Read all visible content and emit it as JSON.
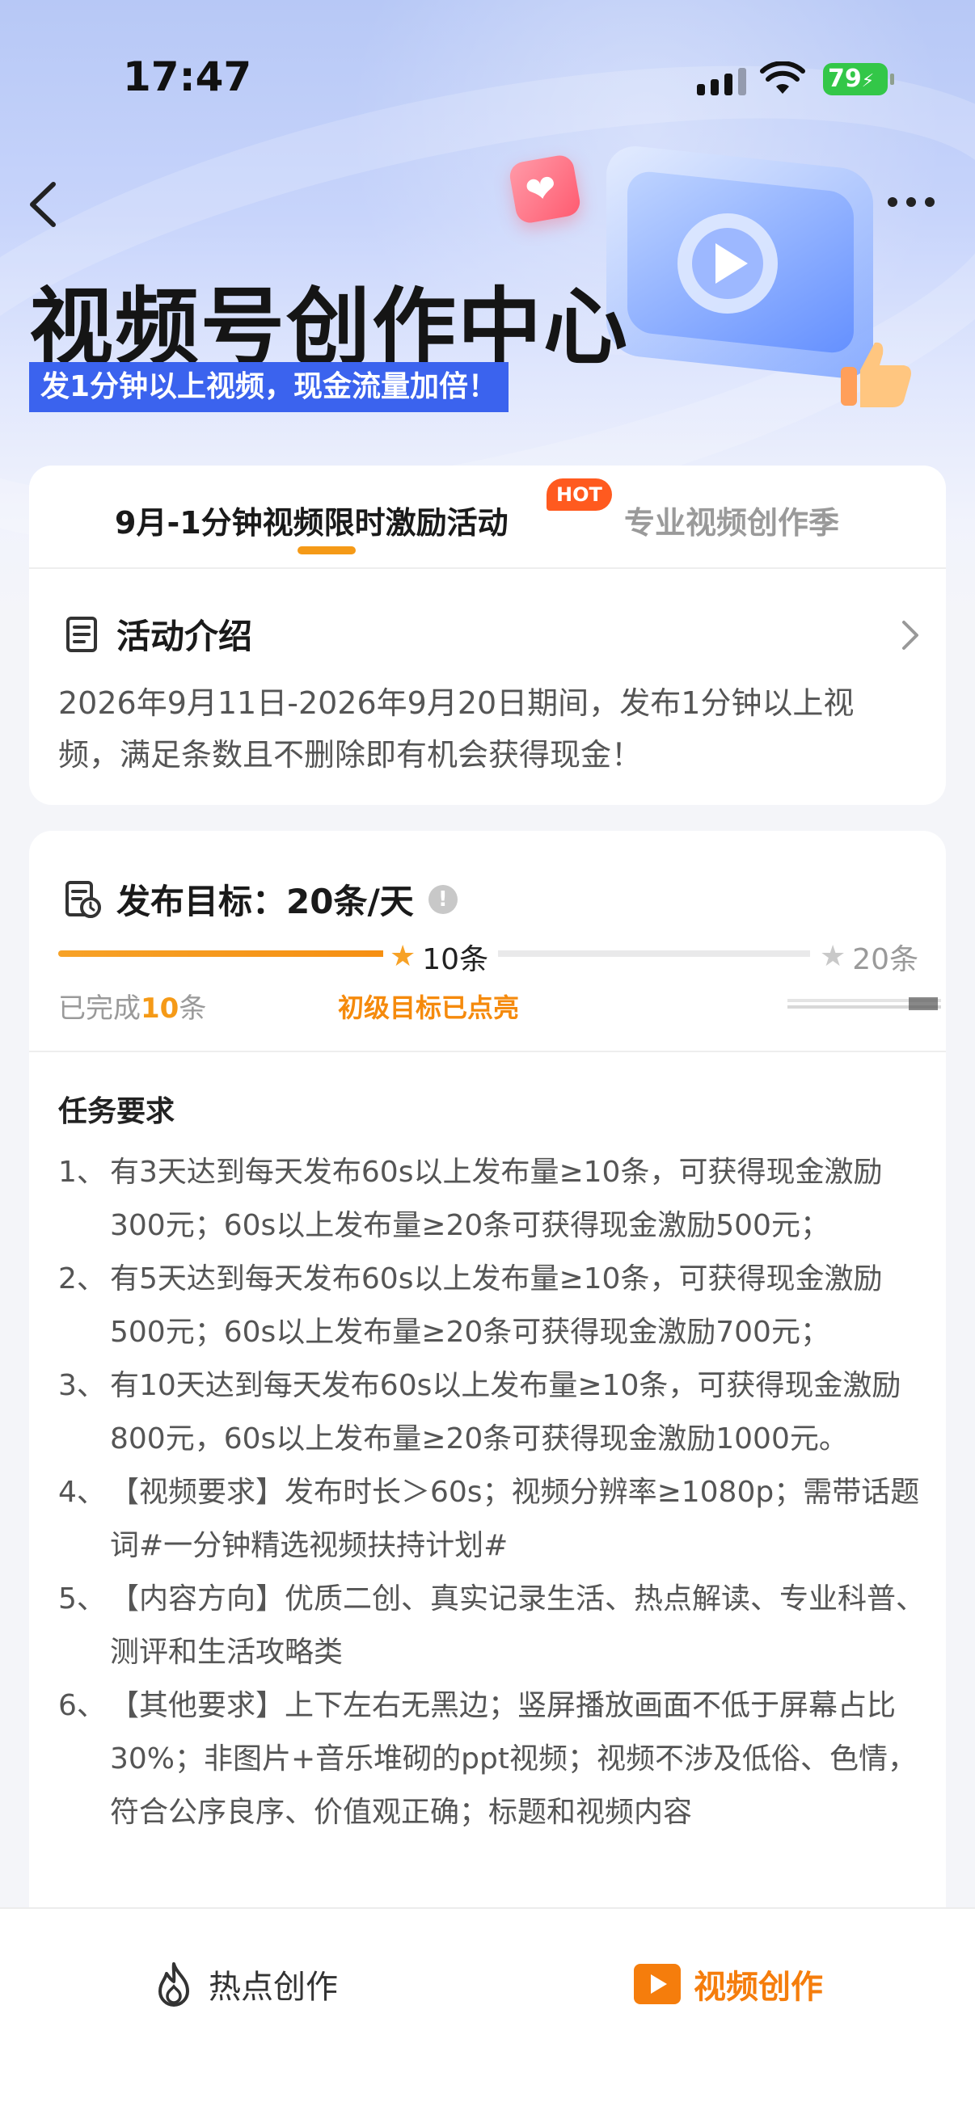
{
  "status_bar": {
    "time": "17:47",
    "battery": "79"
  },
  "header": {
    "title": "视频号创作中心",
    "subtitle": "发1分钟以上视频，现金流量加倍！"
  },
  "tabs": [
    {
      "label": "9月-1分钟视频限时激励活动",
      "badge": "HOT",
      "active": true
    },
    {
      "label": "专业视频创作季",
      "active": false
    }
  ],
  "intro": {
    "title": "活动介绍",
    "text": "2026年9月11日-2026年9月20日期间，发布1分钟以上视频，满足条数且不删除即有机会获得现金！"
  },
  "target": {
    "title": "发布目标：20条/天",
    "progress": 0.5,
    "milestone1": "10条",
    "milestone2": "20条",
    "completed_prefix": "已完成",
    "completed_count": "10",
    "completed_suffix": "条",
    "status": "初级目标已点亮"
  },
  "requirements": {
    "title": "任务要求",
    "items": [
      {
        "num": "1、",
        "text": "有3天达到每天发布60s以上发布量≥10条，可获得现金激励300元；60s以上发布量≥20条可获得现金激励500元；"
      },
      {
        "num": "2、",
        "text": "有5天达到每天发布60s以上发布量≥10条，可获得现金激励500元；60s以上发布量≥20条可获得现金激励700元；"
      },
      {
        "num": "3、",
        "text": "有10天达到每天发布60s以上发布量≥10条，可获得现金激励800元，60s以上发布量≥20条可获得现金激励1000元。"
      },
      {
        "num": "4、",
        "text": "【视频要求】发布时长＞60s；视频分辨率≥1080p；需带话题词#一分钟精选视频扶持计划#"
      },
      {
        "num": "5、",
        "text": "【内容方向】优质二创、真实记录生活、热点解读、专业科普、测评和生活攻略类"
      },
      {
        "num": "6、",
        "text": "【其他要求】上下左右无黑边；竖屏播放画面不低于屏幕占比30%；非图片+音乐堆砌的ppt视频；视频不涉及低俗、色情，符合公序良序、价值观正确；标题和视频内容"
      }
    ]
  },
  "bottom_bar": {
    "left_label": "热点创作",
    "right_label": "视频创作"
  },
  "colors": {
    "accent": "#f59a17",
    "brand_blue": "#3b63ee",
    "hot": "#ff5a1f"
  }
}
